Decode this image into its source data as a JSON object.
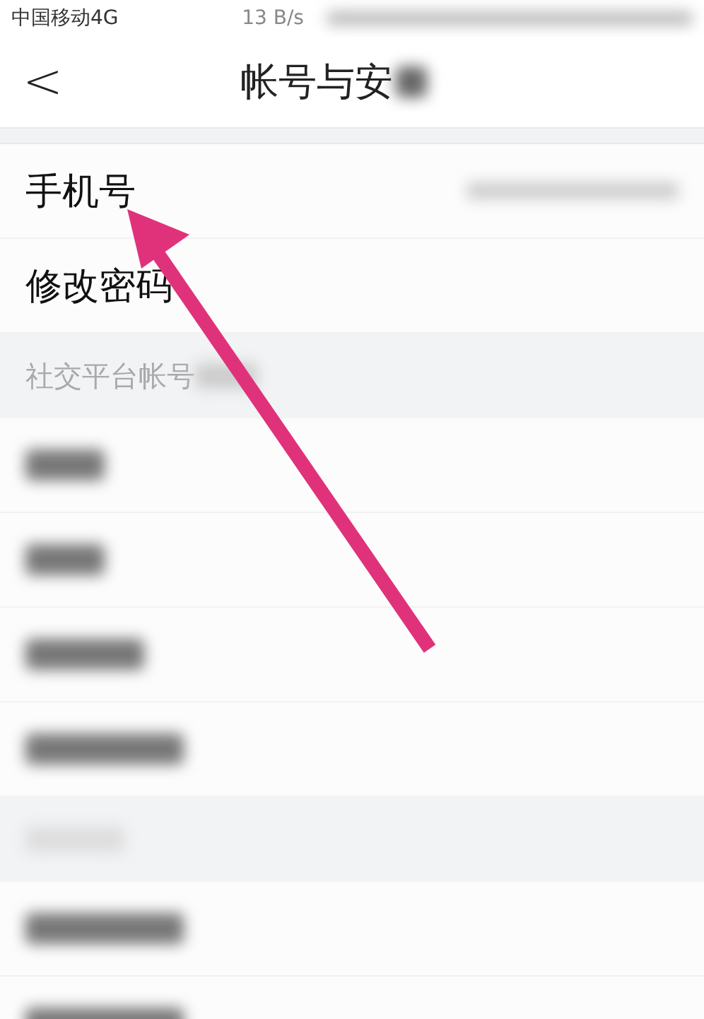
{
  "status_bar": {
    "carrier": "中国移动4G",
    "speed": "13 B/s"
  },
  "nav": {
    "back": "<",
    "title": "帐号与安"
  },
  "rows": [
    {
      "kind": "masked-item",
      "label": "手机号"
    },
    {
      "kind": "item",
      "label": "修改密码"
    },
    {
      "kind": "header",
      "label": "社交平台帐号"
    },
    {
      "kind": "blurred"
    },
    {
      "kind": "blurred"
    },
    {
      "kind": "blurred"
    },
    {
      "kind": "blurred"
    },
    {
      "kind": "blurred-header"
    },
    {
      "kind": "blurred"
    },
    {
      "kind": "blurred"
    }
  ]
}
